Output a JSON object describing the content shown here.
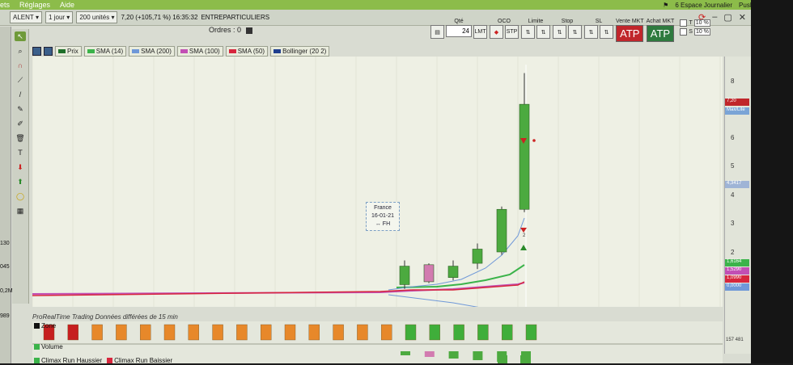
{
  "menu": [
    "ets",
    "Réglages",
    "Aide"
  ],
  "menu_right": [
    "6 Espace Journalier",
    "Push"
  ],
  "toolbar": {
    "symbol": "ALENT",
    "period": "1 jour",
    "units": "200 unités",
    "price_info": "7,20 (+105,71 %) 16:35:32",
    "market": "ENTREPARTICULIERS"
  },
  "orders": {
    "label": "Ordres :",
    "count": "0"
  },
  "trade": {
    "qty_label": "Qté",
    "qty": "24",
    "lmt": "LMT",
    "oco": "OCO",
    "stp": "STP",
    "limite": "Limite",
    "stop": "Stop",
    "sl": "SL",
    "vente_label": "Vente MKT",
    "achat_label": "Achat MKT",
    "vente": "ATP",
    "achat": "ATP",
    "t_label": "T",
    "s_label": "S",
    "pct1": "10 %",
    "pct2": "10 %"
  },
  "legend": [
    {
      "label": "Prix",
      "color": "#1f6f2a"
    },
    {
      "label": "SMA (14)",
      "color": "#3bb34a"
    },
    {
      "label": "SMA (200)",
      "color": "#6f98d8"
    },
    {
      "label": "SMA (100)",
      "color": "#c24fb4"
    },
    {
      "label": "SMA (50)",
      "color": "#d7263d"
    },
    {
      "label": "Bollinger (20 2)",
      "color": "#1f3f8f"
    }
  ],
  "yaxis": [
    "8",
    "7",
    "6",
    "5",
    "4",
    "3",
    "2"
  ],
  "price_tags": [
    "7,20",
    "Max/Lite",
    "4,3417",
    "1,6164",
    "1,5290",
    "1,0990",
    "0,0000"
  ],
  "left_values": [
    "130",
    "045",
    "0,2M",
    "989"
  ],
  "note": {
    "line1": "France",
    "line2": "16-01-21",
    "line3": "↔ FH"
  },
  "marker_label": "2",
  "footer": "ProRealTime Trading Données différées de 15 min",
  "indicators": {
    "zone": "Zone",
    "volume": "Volume",
    "climax_up": "Climax Run Haussier",
    "climax_down": "Climax Run Baissier",
    "volume_value": "157 481"
  },
  "candles": [
    {
      "o": 0.85,
      "c": 1.5,
      "h": 1.7,
      "l": 0.7,
      "color": "green"
    },
    {
      "o": 1.55,
      "c": 0.95,
      "h": 1.6,
      "l": 0.9,
      "color": "pink"
    },
    {
      "o": 1.1,
      "c": 1.5,
      "h": 1.7,
      "l": 1.0,
      "color": "green"
    },
    {
      "o": 1.6,
      "c": 2.1,
      "h": 2.3,
      "l": 1.4,
      "color": "green"
    },
    {
      "o": 2.0,
      "c": 3.5,
      "h": 3.6,
      "l": 1.9,
      "color": "green"
    },
    {
      "o": 3.5,
      "c": 7.2,
      "h": 8.3,
      "l": 3.4,
      "color": "green"
    }
  ],
  "zone_colors": [
    "red",
    "red",
    "orange",
    "orange",
    "orange",
    "orange",
    "orange",
    "orange",
    "orange",
    "orange",
    "orange",
    "orange",
    "orange",
    "orange",
    "orange",
    "green",
    "green",
    "green",
    "green",
    "green",
    "green"
  ],
  "volume_colors": [
    "green",
    "pink",
    "green",
    "green",
    "green",
    "green"
  ]
}
